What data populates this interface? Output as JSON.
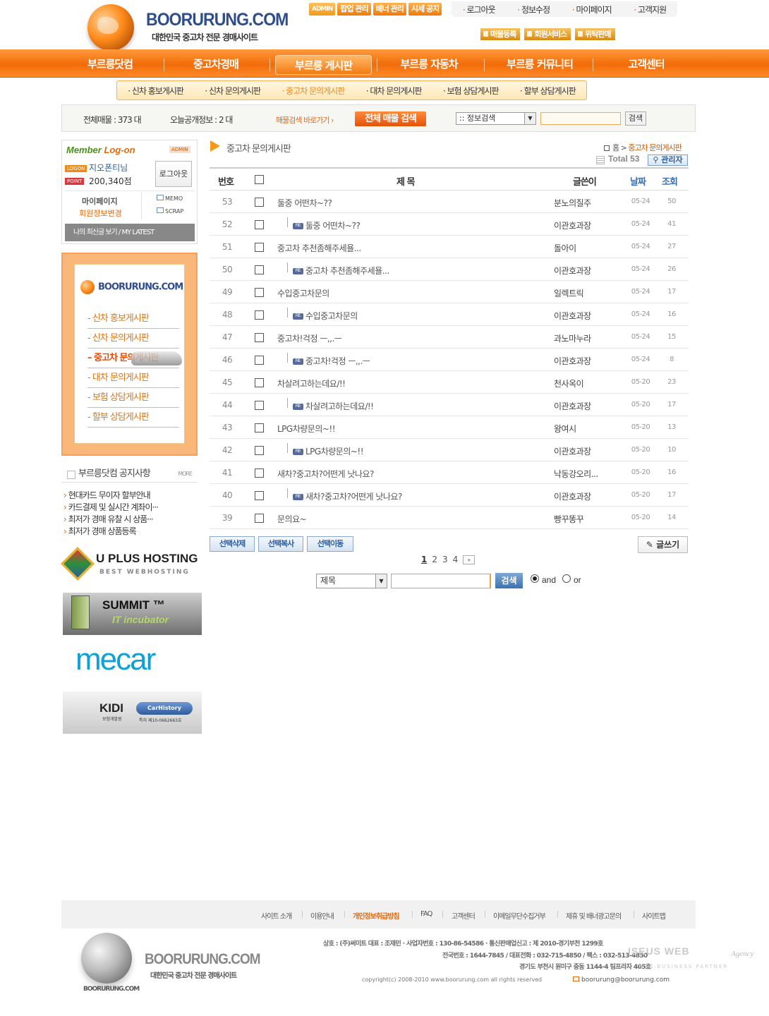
{
  "site": {
    "logo_text": "BOORURUNG.COM",
    "logo_sub": "대한민국 중고차 전문 경매사이트"
  },
  "admin_buttons": [
    "ADMIN",
    "팝업 관리",
    "배너 관리",
    "시세 공지"
  ],
  "top_menu": [
    "로그아웃",
    "정보수정",
    "마이페이지",
    "고객지원"
  ],
  "sub_buttons": [
    "매물등록",
    "회원서비스",
    "위탁판매"
  ],
  "nav": [
    "부르릉닷컴",
    "중고차경매",
    "부르릉 게시판",
    "부르릉 자동차",
    "부르릉 커뮤니티",
    "고객센터"
  ],
  "subnav": [
    "신차 홍보게시판",
    "신차 문의게시판",
    "중고차 문의게시판",
    "대차 문의게시판",
    "보험 상담게시판",
    "할부 상담게시판"
  ],
  "search_bar": {
    "total_label": "전체매물 :",
    "total_value": "373 대",
    "today_label": "오늘공개정보 :",
    "today_value": "2 대",
    "shortcut": "매물검색 바로가기 ›",
    "all_search": "전체 매물 검색",
    "select_value": ":: 정보검색",
    "search_btn": "검색"
  },
  "member": {
    "title_a": "Member",
    "title_b": "Log-on",
    "admin_badge": "ADMIN",
    "logon_badge": "LOGON",
    "point_badge": "POINT",
    "user": "지오폰티님",
    "points": "200,340점",
    "logout": "로그아웃",
    "mypage": "마이페이지",
    "edit": "회원정보변경",
    "memo": "MEMO",
    "scrap": "SCRAP",
    "latest": "나의 최신글 보기 / MY LATEST"
  },
  "side_menu": {
    "logo": "BOORURUNG.COM",
    "items": [
      "신차 홍보게시판",
      "신차 문의게시판",
      "중고차 문의게시판",
      "대차 문의게시판",
      "보험 상담게시판",
      "할부 상담게시판"
    ]
  },
  "notice": {
    "title": "부르릉닷컴 공지사항",
    "more": "MORE",
    "items": [
      "현대카드 무이자 할부안내",
      "카드결제 및 실시간 계좌이···",
      "최저가 경매 유찰 시 상품···",
      "최저가 경매 상품등록"
    ]
  },
  "banners": {
    "uplus": "U PLUS HOSTING",
    "uplus_sub": "BEST WEBHOSTING",
    "summit": "SUMMIT ™",
    "summit_sub": "IT incubator",
    "mecar": "mecar",
    "kidi": "KIDI",
    "kidi_sub": "보험개발원",
    "carhistory": "CarHistory",
    "carhistory_sub": "특허 제10-0662663호"
  },
  "board": {
    "title": "중고차 문의게시판",
    "crumb_home": "홈",
    "crumb_sep": ">",
    "crumb_current": "중고차 문의게시판",
    "total": "Total 53",
    "admin": "관리자",
    "headers": {
      "no": "번호",
      "subject": "제 목",
      "writer": "글쓴이",
      "date": "날짜",
      "hits": "조회"
    },
    "rows": [
      {
        "no": "53",
        "subject": "둘중 어떤차~??",
        "writer": "분노의질주",
        "date": "05-24",
        "hits": "50",
        "reply": false
      },
      {
        "no": "52",
        "subject": "둘중 어떤차~??",
        "writer": "이관호과장",
        "date": "05-24",
        "hits": "41",
        "reply": true
      },
      {
        "no": "51",
        "subject": "중고차 추천좀해주세욜...",
        "writer": "돌아이",
        "date": "05-24",
        "hits": "27",
        "reply": false
      },
      {
        "no": "50",
        "subject": "중고차 추천좀해주세욜...",
        "writer": "이관호과장",
        "date": "05-24",
        "hits": "26",
        "reply": true
      },
      {
        "no": "49",
        "subject": "수입중고차문의",
        "writer": "일렉트릭",
        "date": "05-24",
        "hits": "17",
        "reply": false
      },
      {
        "no": "48",
        "subject": "수입중고차문의",
        "writer": "이관호과장",
        "date": "05-24",
        "hits": "16",
        "reply": true
      },
      {
        "no": "47",
        "subject": "중고차!걱정 ㅡ,,.ㅡ",
        "writer": "과노마누라",
        "date": "05-24",
        "hits": "15",
        "reply": false
      },
      {
        "no": "46",
        "subject": "중고차!걱정 ㅡ,,.ㅡ",
        "writer": "이관호과장",
        "date": "05-24",
        "hits": "8",
        "reply": true
      },
      {
        "no": "45",
        "subject": "차살려고하는데요/!!",
        "writer": "천사옥이",
        "date": "05-20",
        "hits": "23",
        "reply": false
      },
      {
        "no": "44",
        "subject": "차살려고하는데요/!!",
        "writer": "이관호과장",
        "date": "05-20",
        "hits": "17",
        "reply": true
      },
      {
        "no": "43",
        "subject": "LPG차량문의~!!",
        "writer": "왕여시",
        "date": "05-20",
        "hits": "13",
        "reply": false
      },
      {
        "no": "42",
        "subject": "LPG차량문의~!!",
        "writer": "이관호과장",
        "date": "05-20",
        "hits": "10",
        "reply": true
      },
      {
        "no": "41",
        "subject": "새차?중고차?어떤게 낫나요?",
        "writer": "낙동강오리...",
        "date": "05-20",
        "hits": "16",
        "reply": false
      },
      {
        "no": "40",
        "subject": "새차?중고차?어떤게 낫나요?",
        "writer": "이관호과장",
        "date": "05-20",
        "hits": "17",
        "reply": true
      },
      {
        "no": "39",
        "subject": "문의요~",
        "writer": "빵꾸똥꾸",
        "date": "05-20",
        "hits": "14",
        "reply": false
      }
    ],
    "re_badge": "RE",
    "actions": [
      "선택삭제",
      "선택복사",
      "선택이동"
    ],
    "write": "글쓰기",
    "pages": [
      "1",
      "2",
      "3",
      "4"
    ],
    "next": "»",
    "search_field": "제목",
    "search_btn": "검색",
    "and": "and",
    "or": "or"
  },
  "footer": {
    "menu": [
      "사이트 소개",
      "이용안내",
      "개인정보취급방침",
      "FAQ",
      "고객센터",
      "이메일무단수집거부",
      "제휴 및 배너광고문의",
      "사이트맵"
    ],
    "logo": "BOORURUNG.COM",
    "logo_sub": "대한민국 중고차 전문 경매사이트",
    "logo_small": "BOORURUNG.COM",
    "line1": "상호 : (주)써미트    대표 : 조재민    · 사업자번호 : 130-86-54586    · 통신판매업신고 : 제 2010-경기부천 1299호",
    "line2": "전국번호 : 1644-7845  /  대표전화 : 032-715-4850  /  팩스 : 032-513-4850",
    "line3": "경기도 부천시 원미구 중동 1144-4 팀프라자 405호",
    "copyright": "copyright(c) 2008-2010 www.boorurung.com all rights reserved",
    "email": "boorurung@boorurung.com",
    "watermark": "ISEUS WEB",
    "watermark_sub": "WEB BUSINESS PARTNER",
    "watermark_script": "Agency"
  },
  "colors": {
    "accent": "#f26c08",
    "link_blue": "#2f5d99",
    "brand_blue": "#2f4d8c"
  }
}
